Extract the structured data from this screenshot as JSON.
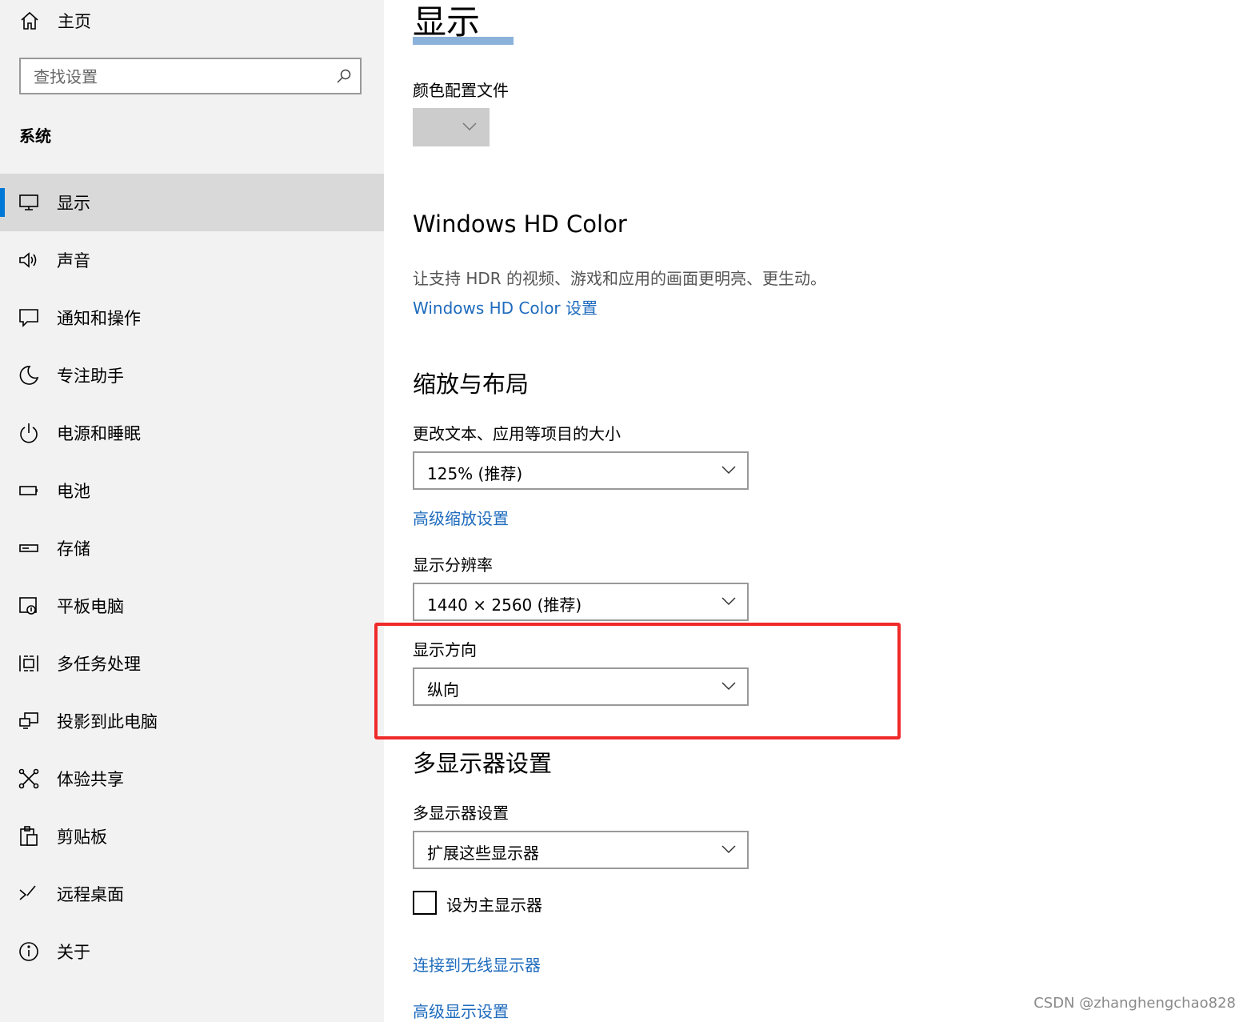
{
  "sidebar": {
    "home_label": "主页",
    "search_placeholder": "查找设置",
    "section_title": "系统",
    "items": [
      {
        "label": "显示",
        "icon": "monitor-icon"
      },
      {
        "label": "声音",
        "icon": "speaker-icon"
      },
      {
        "label": "通知和操作",
        "icon": "notification-icon"
      },
      {
        "label": "专注助手",
        "icon": "moon-icon"
      },
      {
        "label": "电源和睡眠",
        "icon": "power-icon"
      },
      {
        "label": "电池",
        "icon": "battery-icon"
      },
      {
        "label": "存储",
        "icon": "storage-icon"
      },
      {
        "label": "平板电脑",
        "icon": "tablet-icon"
      },
      {
        "label": "多任务处理",
        "icon": "multitask-icon"
      },
      {
        "label": "投影到此电脑",
        "icon": "project-icon"
      },
      {
        "label": "体验共享",
        "icon": "share-icon"
      },
      {
        "label": "剪贴板",
        "icon": "clipboard-icon"
      },
      {
        "label": "远程桌面",
        "icon": "remote-desktop-icon"
      },
      {
        "label": "关于",
        "icon": "info-icon"
      }
    ],
    "selected_index": 0
  },
  "main": {
    "title": "显示",
    "color_profile_label": "颜色配置文件",
    "hd_color": {
      "heading": "Windows HD Color",
      "description": "让支持 HDR 的视频、游戏和应用的画面更明亮、更生动。",
      "link": "Windows HD Color 设置"
    },
    "scale_layout": {
      "heading": "缩放与布局",
      "scale_label": "更改文本、应用等项目的大小",
      "scale_value": "125% (推荐)",
      "advanced_scaling_link": "高级缩放设置",
      "resolution_label": "显示分辨率",
      "resolution_value": "1440 × 2560 (推荐)",
      "orientation_label": "显示方向",
      "orientation_value": "纵向"
    },
    "multi_display": {
      "heading": "多显示器设置",
      "label": "多显示器设置",
      "value": "扩展这些显示器",
      "main_display_checkbox": "设为主显示器",
      "wireless_link": "连接到无线显示器",
      "advanced_link": "高级显示设置"
    }
  },
  "watermark": "CSDN @zhanghengchao828",
  "colors": {
    "accent": "#0078d7",
    "link": "#1e6bbd",
    "highlight_box": "#f02a2a",
    "sidebar_bg": "#f2f2f2",
    "selected_bg": "#d9d9d9"
  }
}
